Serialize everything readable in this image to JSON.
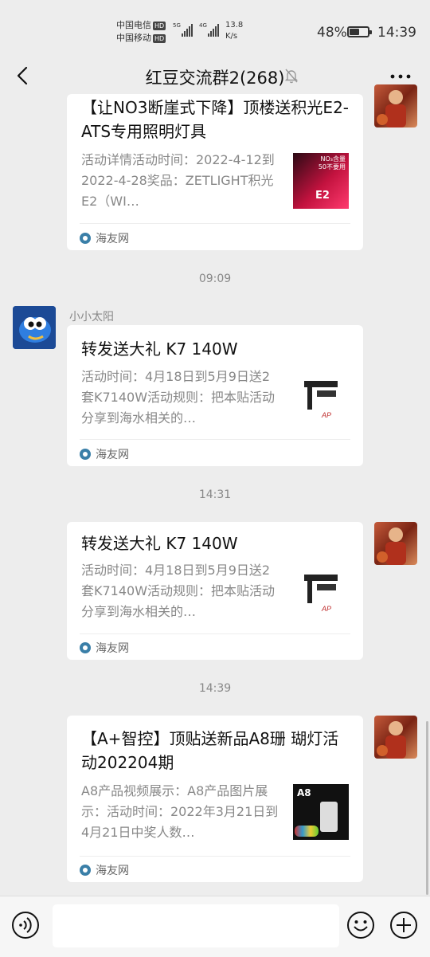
{
  "status_bar": {
    "carrier1": "中国电信",
    "carrier2": "中国移动",
    "hd": "HD",
    "sig1": "5G",
    "sig2": "4G",
    "net_speed_value": "13.8",
    "net_speed_unit": "K/s",
    "battery_percent": "48%",
    "time": "14:39"
  },
  "header": {
    "title": "红豆交流群2(268)"
  },
  "messages": [
    {
      "title": "【让NO3断崖式下降】顶楼送积光E2-ATS专用照明灯具",
      "desc": "活动详情活动时间：2022-4-12到2022-4-28奖品：ZETLIGHT积光E2（WI…",
      "source": "海友网",
      "thumb_text1": "NO₃含量",
      "thumb_text2": "50不要用",
      "thumb_text3": "E2"
    },
    {
      "timestamp": "09:09",
      "sender": "小小太阳",
      "title": "转发送大礼 K7 140W",
      "desc": "活动时间：4月18日到5月9日送2套K7140W活动规则：把本贴活动分享到海水相关的…",
      "source": "海友网"
    },
    {
      "timestamp": "14:31",
      "title": "转发送大礼 K7 140W",
      "desc": "活动时间：4月18日到5月9日送2套K7140W活动规则：把本贴活动分享到海水相关的…",
      "source": "海友网"
    },
    {
      "timestamp": "14:39",
      "title": "【A+智控】顶贴送新品A8珊 瑚灯活动202204期",
      "desc": "A8产品视频展示：A8产品图片展示：活动时间：2022年3月21日到4月21日中奖人数…",
      "source": "海友网",
      "thumb_text": "A8"
    }
  ],
  "icons": {
    "back": "back-arrow-icon",
    "mute": "mute-bell-icon",
    "more": "more-dots-icon",
    "voice": "voice-icon",
    "emoji": "emoji-icon",
    "plus": "plus-icon",
    "source": "haiyou-logo-icon"
  }
}
